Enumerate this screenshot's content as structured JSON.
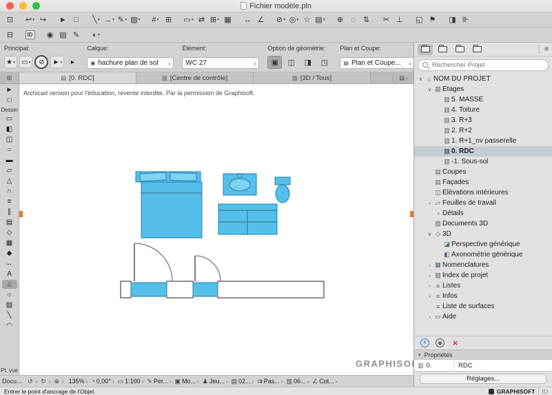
{
  "ui": {
    "chevron": "›",
    "dropdown": "▾"
  },
  "colors": {
    "selection_blue": "#55bfe9",
    "selection_stroke": "#1f7fae",
    "marker_orange": "#e8762d",
    "delete_red": "#d12e2e",
    "accent_blue": "#2e7dd1"
  },
  "titlebar": {
    "title": "Fichier modèle.pln"
  },
  "toolbar_row1": [
    {
      "name": "save-icon",
      "glyph": "⊡"
    },
    {
      "name": "undo-icon",
      "glyph": "↩",
      "gap": true,
      "dd": true
    },
    {
      "name": "redo-icon",
      "glyph": "↪"
    },
    {
      "name": "select-arrow-icon",
      "glyph": "►",
      "gap": true
    },
    {
      "name": "marquee-icon",
      "glyph": "□"
    },
    {
      "name": "line-type-icon",
      "glyph": "╲",
      "gap": true,
      "dd": true
    },
    {
      "name": "arrow-style-icon",
      "glyph": "→",
      "dd": true
    },
    {
      "name": "pen-color-icon",
      "glyph": "✎",
      "dd": true
    },
    {
      "name": "fill-type-icon",
      "glyph": "▨",
      "dd": true
    },
    {
      "name": "grid-snap-icon",
      "glyph": "#",
      "gap": true,
      "dd": true
    },
    {
      "name": "guide-lines-icon",
      "glyph": "⊞"
    },
    {
      "name": "view-frame-icon",
      "glyph": "▭",
      "gap": true,
      "dd": true
    },
    {
      "name": "orientation-icon",
      "glyph": "⇄"
    },
    {
      "name": "column-grid-icon",
      "glyph": "⊞",
      "dd": true
    },
    {
      "name": "schedule-icon",
      "glyph": "▦"
    },
    {
      "name": "dimension-icon",
      "glyph": "↔",
      "gap": true
    },
    {
      "name": "angle-dimension-icon",
      "glyph": "∠"
    },
    {
      "name": "section-marker-icon",
      "glyph": "⊘",
      "gap": true,
      "dd": true
    },
    {
      "name": "camera-icon",
      "glyph": "◎",
      "dd": true
    },
    {
      "name": "favorites-star-icon",
      "glyph": "☆"
    },
    {
      "name": "worksheet-icon",
      "glyph": "▤",
      "dd": true
    },
    {
      "name": "zoom-in-icon",
      "glyph": "⊕",
      "gap": true
    },
    {
      "name": "find-select-icon",
      "glyph": "◌"
    },
    {
      "name": "pan-icon",
      "glyph": "⇅"
    },
    {
      "name": "scissors-icon",
      "glyph": "✂",
      "gap": true
    },
    {
      "name": "split-icon",
      "glyph": "⊥"
    },
    {
      "name": "group-icon",
      "glyph": "◱",
      "gap": true
    },
    {
      "name": "flag-icon",
      "glyph": "⚑"
    },
    {
      "name": "panel-toggle-icon",
      "glyph": "◨",
      "gap": true
    },
    {
      "name": "pin-icon",
      "glyph": "⊪"
    }
  ],
  "toolbar_row2": [
    {
      "name": "quick-options-icon",
      "glyph": "⊟"
    },
    {
      "name": "id-badge",
      "glyph": "ID",
      "idb": true,
      "gap": true
    },
    {
      "name": "eye-icon",
      "glyph": "◉",
      "gap": true
    },
    {
      "name": "layers-icon",
      "glyph": "▤"
    },
    {
      "name": "pens-icon",
      "glyph": "✎"
    },
    {
      "name": "trace-reference-icon",
      "glyph": "◐",
      "gap": true,
      "dd": true
    }
  ],
  "infobar": {
    "principal_label": "Principal:",
    "principal_buttons": [
      {
        "name": "favorites-button",
        "glyph": "★",
        "dd": true
      },
      {
        "name": "default-transfer-button",
        "glyph": "▭",
        "dd": true
      },
      {
        "name": "method-toggle-button",
        "glyph": "⊘",
        "circle": true,
        "selected": true
      },
      {
        "name": "arrow-tool-button",
        "glyph": "►",
        "dd": true
      },
      {
        "name": "principal-more-button",
        "glyph": "▸",
        "plain": true
      }
    ],
    "calque_label": "Calque:",
    "calque_eye_glyph": "◉",
    "calque_value": "hachure plan de sol",
    "element_label": "Élément:",
    "element_value": "WC 27",
    "geometry_label": "Option de géométrie:",
    "geometry_buttons": [
      {
        "name": "geometry-method-1",
        "glyph": "▣",
        "selected": true
      },
      {
        "name": "geometry-method-2",
        "glyph": "◫"
      },
      {
        "name": "geometry-method-3",
        "glyph": "◨"
      },
      {
        "name": "geometry-method-4",
        "glyph": "◳"
      }
    ],
    "plan_label": "Plan et Coupe:",
    "plan_glyph": "▤",
    "plan_value": "Plan et Coupe..."
  },
  "tabbar": {
    "grid_glyph": "⊞",
    "tabs": [
      {
        "label": "[0. RDC]",
        "glyph": "▤",
        "active": true
      },
      {
        "label": "[Centre de contrôle]",
        "glyph": "▥"
      },
      {
        "label": "[3D / Tous]",
        "glyph": "▧"
      }
    ],
    "overflow_glyph": "▤"
  },
  "palette": {
    "select_tools": [
      {
        "name": "arrow-tool",
        "glyph": "►"
      },
      {
        "name": "marquee-tool",
        "glyph": "□"
      }
    ],
    "dessin_label": "Dessin",
    "tools": [
      {
        "name": "wall-tool",
        "glyph": "▭"
      },
      {
        "name": "door-tool",
        "glyph": "◧"
      },
      {
        "name": "window-tool",
        "glyph": "◫"
      },
      {
        "name": "column-tool",
        "glyph": "○"
      },
      {
        "name": "beam-tool",
        "glyph": "▬"
      },
      {
        "name": "slab-tool",
        "glyph": "▱"
      },
      {
        "name": "roof-tool",
        "glyph": "△"
      },
      {
        "name": "shell-tool",
        "glyph": "∩"
      },
      {
        "name": "stair-tool",
        "glyph": "≡"
      },
      {
        "name": "railing-tool",
        "glyph": "∥"
      },
      {
        "name": "curtain-wall-tool",
        "glyph": "▤"
      },
      {
        "name": "zone-tool",
        "glyph": "◇"
      },
      {
        "name": "mesh-tool",
        "glyph": "▦"
      },
      {
        "name": "morph-tool",
        "glyph": "◆"
      },
      {
        "name": "dimension-tool",
        "glyph": "↔"
      },
      {
        "name": "text-tool",
        "glyph": "A"
      },
      {
        "name": "object-tool",
        "glyph": "⌂",
        "selected": true
      },
      {
        "name": "lamp-tool",
        "glyph": "☼"
      },
      {
        "name": "fill-tool",
        "glyph": "▨"
      },
      {
        "name": "line-tool",
        "glyph": "╲"
      },
      {
        "name": "arc-tool",
        "glyph": "◠"
      }
    ],
    "ptvue_label": "Pt. vue"
  },
  "canvas": {
    "edu_notice": "Archicad version pour l'éducation, revente interdite. Par la permission de Graphisoft.",
    "watermark": "GRAPHISOFT."
  },
  "navigator": {
    "header_tabs": [
      {
        "name": "project-map-tab",
        "active": true
      },
      {
        "name": "view-map-tab"
      },
      {
        "name": "layout-book-tab"
      },
      {
        "name": "publisher-sets-tab"
      }
    ],
    "burger_glyph": "≡",
    "search_placeholder": "Rechercher Projet",
    "tree": [
      {
        "label": "NOM DU PROJET",
        "level": 0,
        "chev": "∨",
        "g": "⌂"
      },
      {
        "label": "Étages",
        "level": 1,
        "chev": "∨",
        "g": "▤"
      },
      {
        "label": "5. MASSE",
        "level": 2,
        "g": "▥"
      },
      {
        "label": "4. Toiture",
        "level": 2,
        "g": "▥"
      },
      {
        "label": "3. R+3",
        "level": 2,
        "g": "▥"
      },
      {
        "label": "2. R+2",
        "level": 2,
        "g": "▥"
      },
      {
        "label": "1. R+1_nv passerelle",
        "level": 2,
        "g": "▥"
      },
      {
        "label": "0. RDC",
        "level": 2,
        "g": "▥",
        "selected": true
      },
      {
        "label": "-1. Sous-sol",
        "level": 2,
        "g": "▥"
      },
      {
        "label": "Coupes",
        "level": 1,
        "g": "▤"
      },
      {
        "label": "Façades",
        "level": 1,
        "g": "▤"
      },
      {
        "label": "Élévations intérieures",
        "level": 1,
        "g": "◫"
      },
      {
        "label": "Feuilles de travail",
        "level": 1,
        "chev": "›",
        "g": "▱"
      },
      {
        "label": "Détails",
        "level": 1,
        "g": "◔"
      },
      {
        "label": "Documents 3D",
        "level": 1,
        "g": "▧"
      },
      {
        "label": "3D",
        "level": 1,
        "chev": "∨",
        "g": "◇"
      },
      {
        "label": "Perspective générique",
        "level": 2,
        "g": "◪"
      },
      {
        "label": "Axonométrie générique",
        "level": 2,
        "g": "◧"
      },
      {
        "label": "Nomenclatures",
        "level": 1,
        "chev": "›",
        "g": "▦"
      },
      {
        "label": "Index de projet",
        "level": 1,
        "chev": "›",
        "g": "▨"
      },
      {
        "label": "Listes",
        "level": 1,
        "chev": "›",
        "g": "≡"
      },
      {
        "label": "Infos",
        "level": 1,
        "chev": "›",
        "g": "≡"
      },
      {
        "label": "Liste de surfaces",
        "level": 1,
        "g": "≡"
      },
      {
        "label": "Aide",
        "level": 1,
        "chev": "›",
        "g": "▭"
      }
    ],
    "actions": [
      {
        "name": "add-viewpoint-button",
        "glyph": "+",
        "add": true
      },
      {
        "name": "eye-button",
        "glyph": "◉",
        "eyec": true
      },
      {
        "name": "delete-button",
        "glyph": "×",
        "del": true
      }
    ],
    "properties_label": "Propriétés",
    "properties_disclosure": "▾",
    "prop_num_glyph": "▥",
    "prop_num": "0.",
    "prop_value": "RDC",
    "settings_button": "Réglages..."
  },
  "bottombar": {
    "docu_label": "Docu...",
    "controls": [
      {
        "name": "previous-zoom-button",
        "glyph": "↺"
      },
      {
        "name": "next-zoom-button",
        "glyph": "↻"
      },
      {
        "name": "fit-in-window-button",
        "glyph": "⊕"
      },
      {
        "name": "zoom-level-control",
        "label": "135%"
      },
      {
        "name": "orientation-control",
        "glyph": "◔",
        "label": "0,00°"
      },
      {
        "name": "scale-control",
        "glyph": "▭",
        "label": "1:100"
      },
      {
        "name": "pen-set-control",
        "glyph": "✎",
        "label": "Per..."
      },
      {
        "name": "model-view-control",
        "glyph": "▣",
        "label": "Mo..."
      },
      {
        "name": "pen-sets-control",
        "glyph": "♟",
        "label": "Jeu..."
      },
      {
        "name": "layer-combination-control",
        "glyph": "▤",
        "label": "02..."
      },
      {
        "name": "renovation-filter-control",
        "glyph": "⇉",
        "label": "Pas..."
      },
      {
        "name": "dimension-style-control",
        "glyph": "▥",
        "label": "06..."
      },
      {
        "name": "dimensioning-control",
        "glyph": "∠",
        "label": "Cot..."
      }
    ]
  },
  "statusbar": {
    "message": "Entrer le point d'ancrage de l'Objet.",
    "brand": "GRAPHISOFT",
    "brand_id": "ID"
  }
}
